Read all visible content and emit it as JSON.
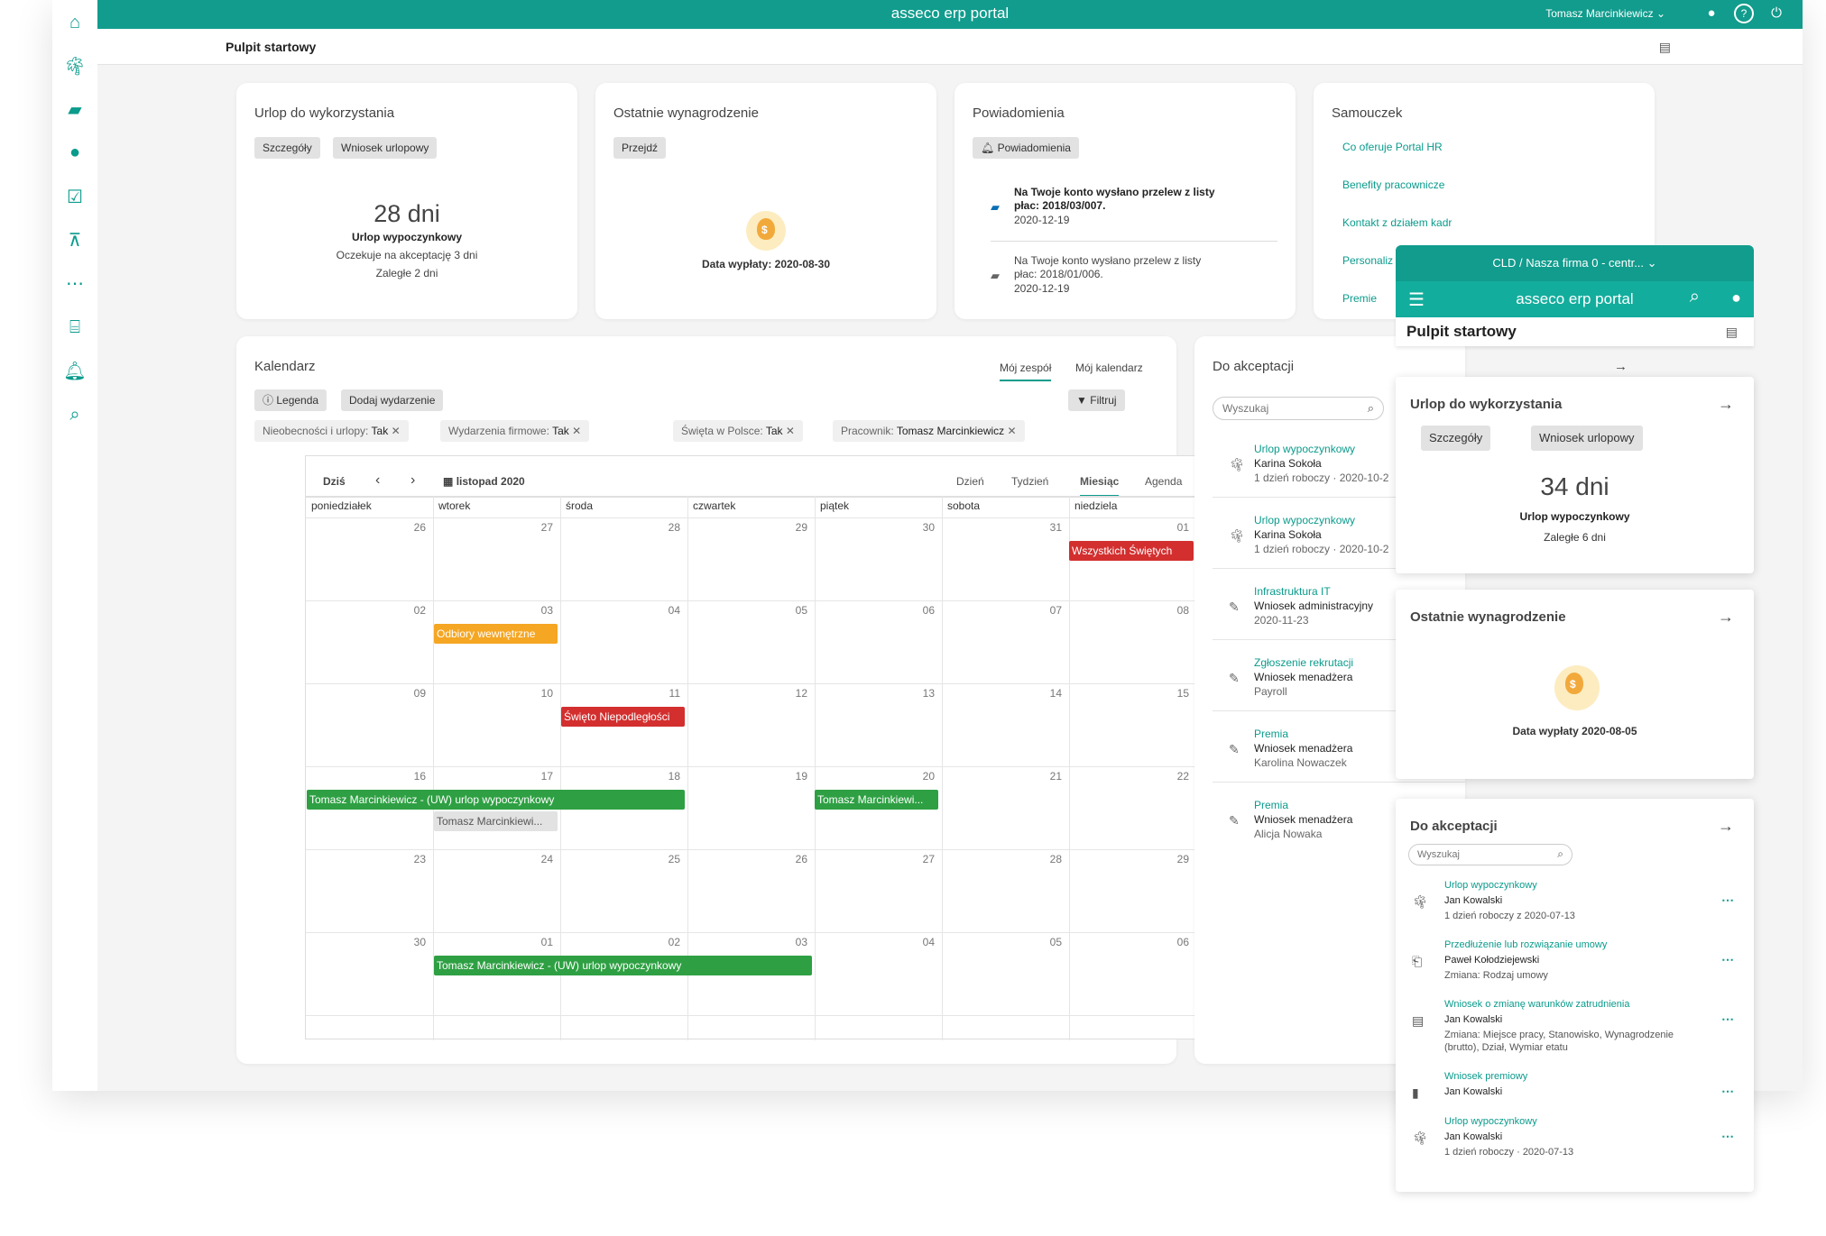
{
  "app": {
    "brand": "asseco erp portal",
    "user": "Tomasz Marcinkiewicz",
    "page_title": "Pulpit startowy"
  },
  "colors": {
    "teal": "#119c8d",
    "green": "#2ea043",
    "red": "#d32f2f",
    "orange": "#f5a623",
    "grey": "#e2e2e2"
  },
  "leave": {
    "title": "Urlop do wykorzystania",
    "btn1": "Szczegóły",
    "btn2": "Wniosek urlopowy",
    "days": "28 dni",
    "type": "Urlop wypoczynkowy",
    "pending": "Oczekuje na akceptację 3 dni",
    "overdue": "Zaległe 2 dni"
  },
  "salary": {
    "title": "Ostatnie wynagrodzenie",
    "btn": "Przejdź",
    "date": "Data wypłaty: 2020-08-30"
  },
  "notifications": {
    "title": "Powiadomienia",
    "btn": "Powiadomienia",
    "items": [
      {
        "text1": "Na Twoje konto wysłano przelew z listy",
        "text2": "płac: 2018/03/007.",
        "date": "2020-12-19"
      },
      {
        "text1": "Na Twoje konto wysłano przelew z listy",
        "text2": "płac: 2018/01/006.",
        "date": "2020-12-19"
      }
    ]
  },
  "tutorial": {
    "title": "Samouczek",
    "links": [
      "Co oferuje Portal HR",
      "Benefity pracownicze",
      "Kontakt z działem kadr",
      "Personaliz",
      "Premie"
    ]
  },
  "calendar": {
    "title": "Kalendarz",
    "tab_team": "Mój zespół",
    "tab_mine": "Mój kalendarz",
    "legend": "Legenda",
    "add": "Dodaj wydarzenie",
    "filter": "Filtruj",
    "filter_count": "4",
    "filters": [
      {
        "label": "Nieobecności i urlopy:",
        "value": "Tak"
      },
      {
        "label": "Wydarzenia firmowe:",
        "value": "Tak"
      },
      {
        "label": "Święta w Polsce:",
        "value": "Tak"
      },
      {
        "label": "Pracownik:",
        "value": "Tomasz Marcinkiewicz"
      }
    ],
    "today": "Dziś",
    "month": "listopad 2020",
    "views": [
      "Dzień",
      "Tydzień",
      "Miesiąc",
      "Agenda"
    ],
    "days": [
      "poniedziałek",
      "wtorek",
      "środa",
      "czwartek",
      "piątek",
      "sobota",
      "niedziela"
    ],
    "weeks": [
      [
        "26",
        "27",
        "28",
        "29",
        "30",
        "31",
        "01"
      ],
      [
        "02",
        "03",
        "04",
        "05",
        "06",
        "07",
        "08"
      ],
      [
        "09",
        "10",
        "11",
        "12",
        "13",
        "14",
        "15"
      ],
      [
        "16",
        "17",
        "18",
        "19",
        "20",
        "21",
        "22"
      ],
      [
        "23",
        "24",
        "25",
        "26",
        "27",
        "28",
        "29"
      ],
      [
        "30",
        "01",
        "02",
        "03",
        "04",
        "05",
        "06"
      ]
    ],
    "events": [
      "Wszystkich Świętych",
      "Odbiory wewnętrzne",
      "Święto Niepodległości",
      "Tomasz Marcinkiewicz - (UW) urlop wypoczynkowy",
      "Tomasz Marcinkiewi...",
      "Tomasz Marcinkiewi...",
      "Tomasz Marcinkiewicz - (UW) urlop wypoczynkowy"
    ]
  },
  "approval": {
    "title": "Do akceptacji",
    "search": "Wyszukaj",
    "items": [
      {
        "link": "Urlop wypoczynkowy",
        "name": "Karina Sokoła",
        "meta": "1 dzień roboczy · 2020-10-2"
      },
      {
        "link": "Urlop wypoczynkowy",
        "name": "Karina Sokoła",
        "meta": "1 dzień roboczy · 2020-10-2"
      },
      {
        "link": "Infrastruktura IT",
        "name": "Wniosek administracyjny",
        "meta": "2020-11-23"
      },
      {
        "link": "Zgłoszenie rekrutacji",
        "name": "Wniosek menadżera",
        "meta": "Payroll"
      },
      {
        "link": "Premia",
        "name": "Wniosek menadżera",
        "meta": "Karolina Nowaczek"
      },
      {
        "link": "Premia",
        "name": "Wniosek menadżera",
        "meta": "Alicja Nowaka"
      }
    ]
  },
  "mobile": {
    "company": "CLD / Nasza firma 0 - centr...",
    "brand": "asseco erp portal",
    "page_title": "Pulpit startowy",
    "leave": {
      "title": "Urlop do wykorzystania",
      "btn1": "Szczegóły",
      "btn2": "Wniosek urlopowy",
      "days": "34 dni",
      "type": "Urlop wypoczynkowy",
      "overdue": "Zaległe 6 dni"
    },
    "salary": {
      "title": "Ostatnie wynagrodzenie",
      "date": "Data wypłaty 2020-08-05"
    },
    "approval": {
      "title": "Do akceptacji",
      "search": "Wyszukaj",
      "items": [
        {
          "link": "Urlop wypoczynkowy",
          "name": "Jan Kowalski",
          "meta": "1 dzień roboczy z 2020-07-13"
        },
        {
          "link": "Przedłużenie lub rozwiązanie umowy",
          "name": "Paweł Kołodziejewski",
          "meta": "Zmiana: Rodzaj umowy"
        },
        {
          "link": "Wniosek o zmianę warunków zatrudnienia",
          "name": "Jan Kowalski",
          "meta": "Zmiana: Miejsce pracy, Stanowisko, Wynagrodzenie",
          "meta2": "(brutto), Dział, Wymiar etatu"
        },
        {
          "link": "Wniosek premiowy",
          "name": "Jan Kowalski"
        },
        {
          "link": "Urlop wypoczynkowy",
          "name": "Jan Kowalski",
          "meta": "1 dzień roboczy · 2020-07-13"
        }
      ]
    }
  }
}
